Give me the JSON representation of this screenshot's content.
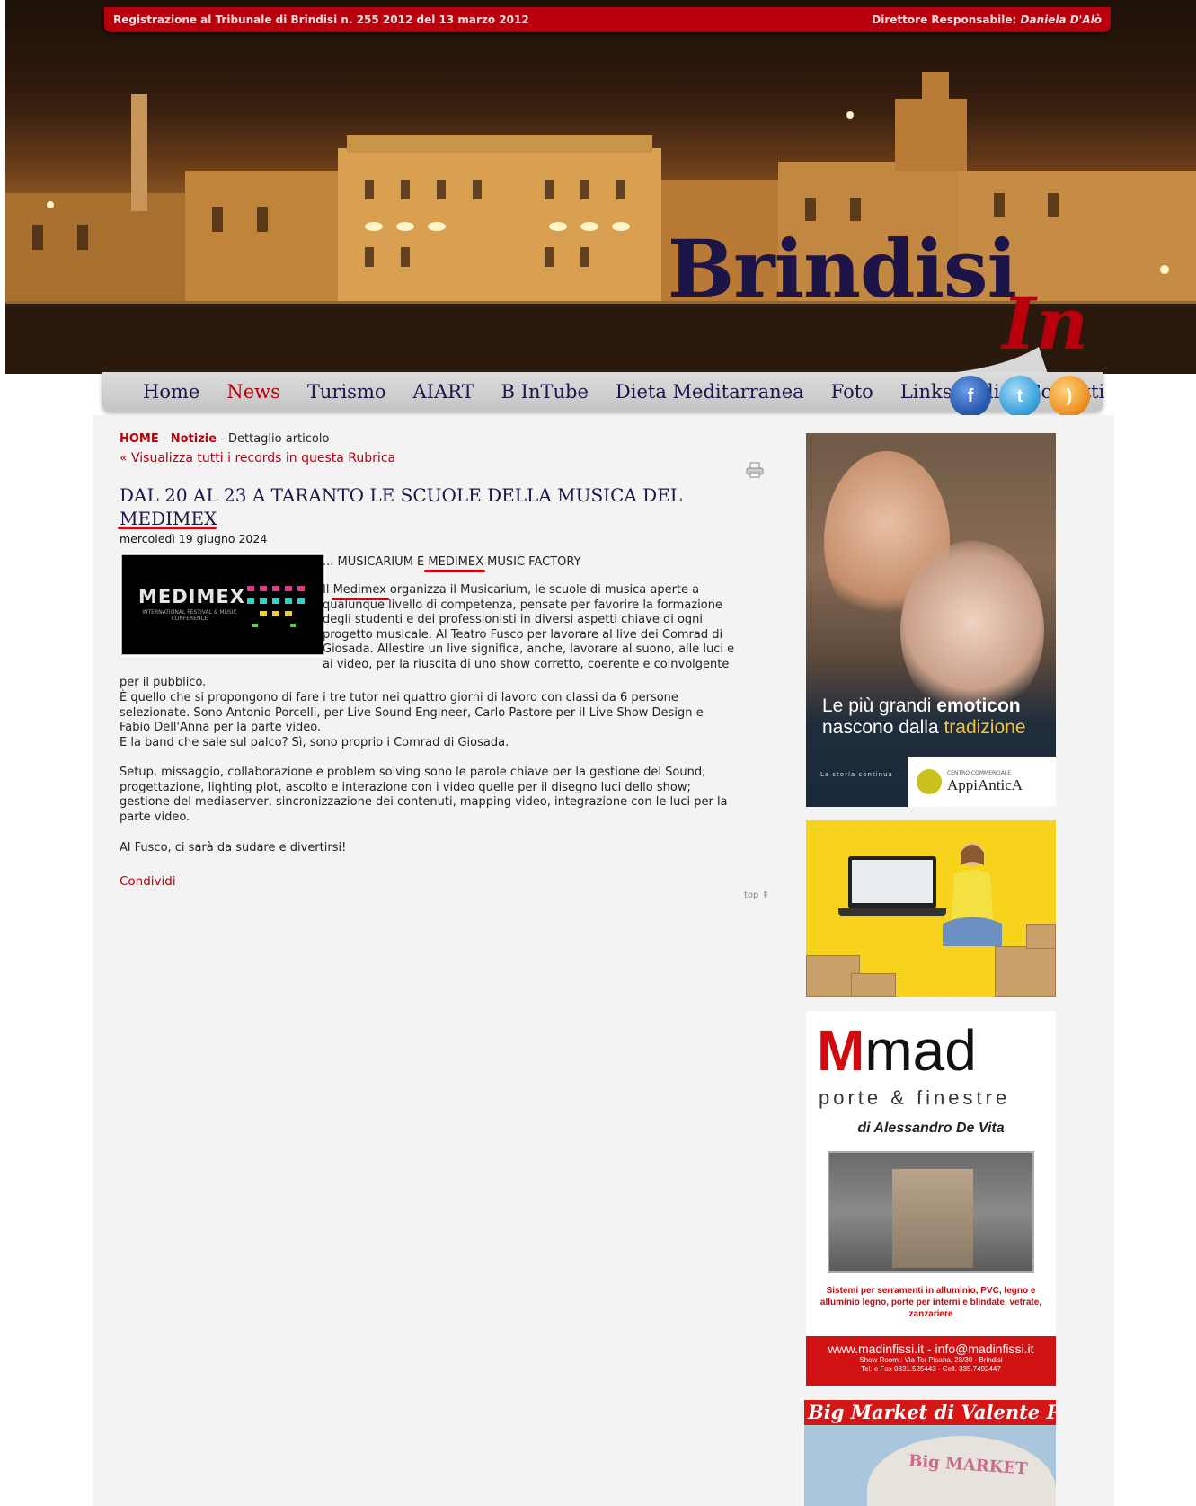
{
  "header": {
    "registration": "Registrazione al Tribunale di Brindisi n. 255 2012  del 13 marzo 2012",
    "director_label": "Direttore Responsabile:",
    "director_name": "Daniela D'Alò",
    "logo_main": "Brindisi",
    "logo_accent": "In"
  },
  "nav": {
    "items": [
      {
        "label": "Home"
      },
      {
        "label": "News"
      },
      {
        "label": "Turismo"
      },
      {
        "label": "AIART"
      },
      {
        "label": "B InTube"
      },
      {
        "label": "Dieta Meditarranea"
      },
      {
        "label": "Foto"
      },
      {
        "label": "Links Utili"
      },
      {
        "label": "Contatti"
      }
    ],
    "active": "News",
    "social": [
      {
        "icon": "facebook-icon",
        "glyph": "f"
      },
      {
        "icon": "twitter-icon",
        "glyph": "t"
      },
      {
        "icon": "rss-icon",
        "glyph": ")"
      }
    ]
  },
  "breadcrumb": {
    "home": "HOME",
    "sep": " - ",
    "section": "Notizie",
    "current": "Dettaglio articolo"
  },
  "rubrica_link": "« Visualizza tutti i records in questa Rubrica",
  "article": {
    "title": "DAL 20 AL 23 A TARANTO LE SCUOLE DELLA MUSICA DEL MEDIMEX",
    "date": "mercoledì 19 giugno 2024",
    "thumb_title": "MEDIMEX",
    "thumb_sub": "INTERNATIONAL FESTIVAL & MUSIC CONFERENCE",
    "lead": "... MUSICARIUM E MEDIMEX MUSIC FACTORY",
    "p1_lines": [
      "Il Medimex organizza il Musicarium, le scuole di musica aperte a",
      "qualunque livello di competenza, pensate per favorire la formazione",
      "degli studenti e dei professionisti in diversi aspetti chiave di ogni",
      "progetto musicale. Al Teatro Fusco per lavorare al live dei Comrad di",
      "Giosada. Allestire un live significa, anche, lavorare al suono, alle luci e",
      "ai video, per la riuscita di uno show corretto, coerente e coinvolgente"
    ],
    "p1_tail": "per il pubblico.",
    "p2_lines": [
      "È quello che si propongono di fare i tre tutor nei quattro giorni di lavoro con classi da 6 persone",
      "selezionate. Sono Antonio Porcelli, per Live Sound Engineer, Carlo Pastore per il Live Show Design e",
      "Fabio Dell'Anna per la parte video.",
      "E la band che sale sul palco? Sì, sono proprio i Comrad di Giosada."
    ],
    "p3_lines": [
      "Setup, missaggio, collaborazione e problem solving sono le parole chiave per la gestione del Sound;",
      "progettazione, lighting plot, ascolto e interazione con i video quelle per il disegno luci dello show;",
      "gestione del mediaserver, sincronizzazione dei contenuti, mapping video, integrazione con le luci per la",
      "parte video."
    ],
    "p4": "Al Fusco, ci sarà da sudare e divertirsi!",
    "share": "Condividi",
    "top": "top ⇞"
  },
  "ads": {
    "appiantica": {
      "line1_a": "Le più grandi ",
      "line1_b": "emoticon",
      "line2_a": "nascono dalla ",
      "line2_b": "tradizione",
      "tagline": "La storia continua",
      "brand_small": "CENTRO COMMERCIALE",
      "brand": "AppiAnticA"
    },
    "mad": {
      "logo": "mad",
      "subtitle": "porte & finestre",
      "owner": "di Alessandro De Vita",
      "desc": "Sistemi per serramenti in alluminio, PVC, legno e alluminio legno, porte per interni e blindate, vetrate, zanzariere",
      "web": "www.madinfissi.it - info@madinfissi.it",
      "showroom": "Show Room : Via Tor Pisana, 28/30 - Brindisi",
      "phone": "Tel. e Fax 0831.525443 - Cell. 335.7492447"
    },
    "bigmarket": {
      "title": "Big Market di Valente Paolo",
      "sign": "Big MARKET"
    }
  },
  "colors": {
    "brand_red": "#b8000d",
    "navy": "#1d1548",
    "page_bg": "#f3f3f3"
  }
}
